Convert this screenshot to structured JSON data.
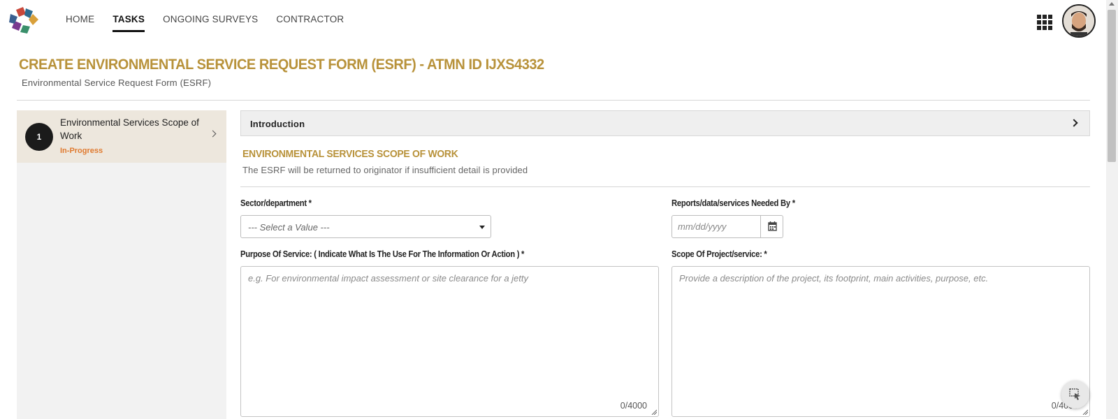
{
  "nav": {
    "items": [
      {
        "label": "HOME",
        "active": false
      },
      {
        "label": "TASKS",
        "active": true
      },
      {
        "label": "ONGOING SURVEYS",
        "active": false
      },
      {
        "label": "CONTRACTOR",
        "active": false
      }
    ],
    "apps_icon": "grid-apps-icon",
    "avatar": "user-avatar"
  },
  "header": {
    "title": "CREATE ENVIRONMENTAL SERVICE REQUEST FORM (ESRF) - ATMN ID IJXS4332",
    "subtitle": "Environmental Service Request Form (ESRF)"
  },
  "steps": [
    {
      "number": "1",
      "title": "Environmental Services Scope of Work",
      "status": "In-Progress"
    }
  ],
  "form": {
    "intro_label": "Introduction",
    "section_title": "ENVIRONMENTAL SERVICES SCOPE OF WORK",
    "section_note": "The ESRF will be returned to originator if insufficient detail is provided",
    "sector": {
      "label": "Sector/department *",
      "value": "--- Select a Value ---"
    },
    "needed_by": {
      "label": "Reports/data/services Needed By *",
      "placeholder": "mm/dd/yyyy"
    },
    "purpose": {
      "label": "Purpose Of Service: ( Indicate What Is The Use For The Information Or Action ) *",
      "placeholder": "e.g. For environmental impact assessment or site clearance for a jetty",
      "counter": "0/4000"
    },
    "scope": {
      "label": "Scope Of Project/service: *",
      "placeholder": "Provide a description of the project, its footprint, main activities, purpose, etc.",
      "counter": "0/4000"
    }
  },
  "colors": {
    "accent_gold": "#b8923a",
    "status_orange": "#e07a2f",
    "step_bg": "#ede7dd",
    "dark": "#1b1b1b"
  }
}
